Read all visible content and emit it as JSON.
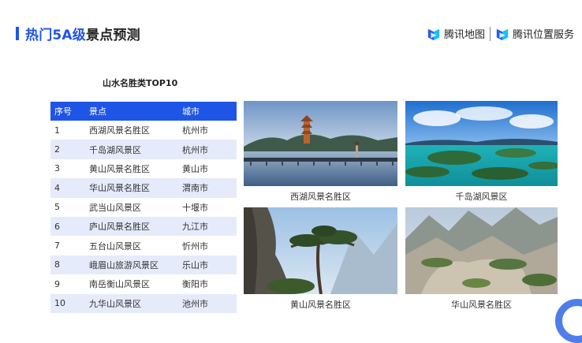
{
  "header": {
    "title_highlight": "热门5A级",
    "title_rest": "景点预测"
  },
  "logos": {
    "map_label": "腾讯地图",
    "location_label": "腾讯位置服务",
    "brand_colors": [
      "#2a5bf0",
      "#16c2f5"
    ]
  },
  "table": {
    "title": "山水名胜类TOP10",
    "headers": [
      "序号",
      "景点",
      "城市"
    ],
    "rows": [
      [
        "1",
        "西湖风景名胜区",
        "杭州市"
      ],
      [
        "2",
        "千岛湖风景区",
        "杭州市"
      ],
      [
        "3",
        "黄山风景名胜区",
        "黄山市"
      ],
      [
        "4",
        "华山风景名胜区",
        "渭南市"
      ],
      [
        "5",
        "武当山风景区",
        "十堰市"
      ],
      [
        "6",
        "庐山风景名胜区",
        "九江市"
      ],
      [
        "7",
        "五台山风景区",
        "忻州市"
      ],
      [
        "8",
        "峨眉山旅游风景区",
        "乐山市"
      ],
      [
        "9",
        "南岳衡山风景区",
        "衡阳市"
      ],
      [
        "10",
        "九华山风景区",
        "池州市"
      ]
    ]
  },
  "photos": [
    {
      "caption": "西湖风景名胜区"
    },
    {
      "caption": "千岛湖风景区"
    },
    {
      "caption": "黄山风景名胜区"
    },
    {
      "caption": "华山风景名胜区"
    }
  ],
  "colors": {
    "accent": "#1f55e6",
    "row_stripe": "#e6ebfb"
  }
}
